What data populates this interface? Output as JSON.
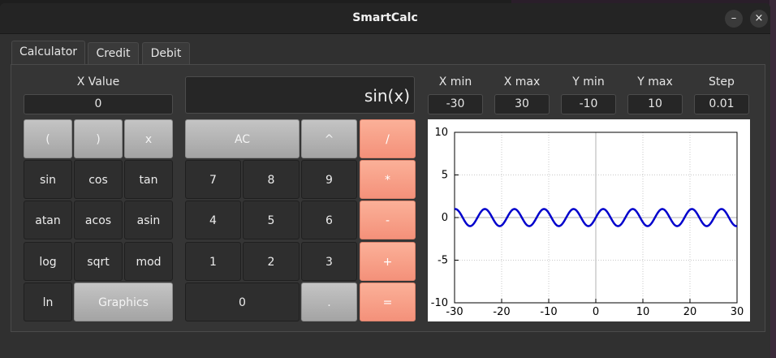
{
  "window": {
    "title": "SmartCalc",
    "minimize_label": "–",
    "close_label": "×"
  },
  "tabs": [
    {
      "label": "Calculator",
      "active": true
    },
    {
      "label": "Credit",
      "active": false
    },
    {
      "label": "Debit",
      "active": false
    }
  ],
  "x_value": {
    "label": "X Value",
    "value": "0"
  },
  "display": {
    "expression": "sin(x)"
  },
  "keypad": {
    "open_paren": "(",
    "close_paren": ")",
    "x": "x",
    "sin": "sin",
    "cos": "cos",
    "tan": "tan",
    "atan": "atan",
    "acos": "acos",
    "asin": "asin",
    "log": "log",
    "sqrt": "sqrt",
    "mod": "mod",
    "ln": "ln",
    "graphics": "Graphics",
    "ac": "AC",
    "pow": "^",
    "div": "/",
    "d7": "7",
    "d8": "8",
    "d9": "9",
    "mul": "*",
    "d4": "4",
    "d5": "5",
    "d6": "6",
    "sub": "-",
    "d1": "1",
    "d2": "2",
    "d3": "3",
    "add": "+",
    "d0": "0",
    "dot": ".",
    "eq": "="
  },
  "range": {
    "x_min": {
      "label": "X min",
      "value": "-30"
    },
    "x_max": {
      "label": "X max",
      "value": "30"
    },
    "y_min": {
      "label": "Y min",
      "value": "-10"
    },
    "y_max": {
      "label": "Y max",
      "value": "10"
    },
    "step": {
      "label": "Step",
      "value": "0.01"
    }
  },
  "colors": {
    "operator": "#f4917a",
    "curve": "#0000cc"
  },
  "chart_data": {
    "type": "line",
    "function": "sin(x)",
    "title": "",
    "xlabel": "",
    "ylabel": "",
    "xlim": [
      -30,
      30
    ],
    "ylim": [
      -10,
      10
    ],
    "x_ticks": [
      -30,
      -20,
      -10,
      0,
      10,
      20,
      30
    ],
    "y_ticks": [
      -10,
      -5,
      0,
      5,
      10
    ],
    "grid": true,
    "series": [
      {
        "color": "#0000cc",
        "x_range": [
          -30,
          30
        ],
        "step": 0.01
      }
    ]
  }
}
